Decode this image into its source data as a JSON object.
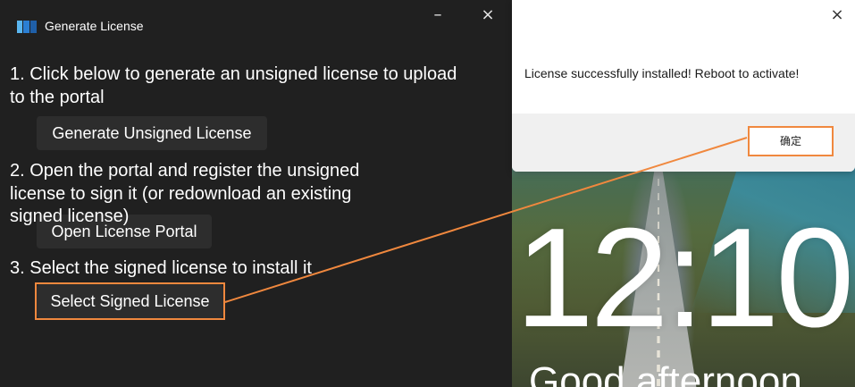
{
  "app": {
    "title": "Generate License",
    "steps": [
      "1. Click below to generate an unsigned license to upload",
      "to the portal",
      "2. Open the portal and register the unsigned",
      "license to sign it (or redownload an existing",
      "signed license)",
      "3. Select the signed license to install it"
    ],
    "buttons": {
      "generate": "Generate Unsigned License",
      "portal": "Open License Portal",
      "select": "Select Signed License"
    },
    "logo_colors": [
      "#5ab6f0",
      "#2b7fd3",
      "#1f5fa8"
    ]
  },
  "dialog": {
    "message": "License successfully installed! Reboot to activate!",
    "ok_label": "确定",
    "close_icon": "×"
  },
  "window_controls": {
    "minimize": "–",
    "close": "×"
  },
  "lockscreen": {
    "time": "12:10",
    "greeting": "Good afternoon"
  },
  "colors": {
    "highlight": "#f0883e",
    "app_bg": "#202020",
    "button_bg": "#2d2d2d"
  }
}
